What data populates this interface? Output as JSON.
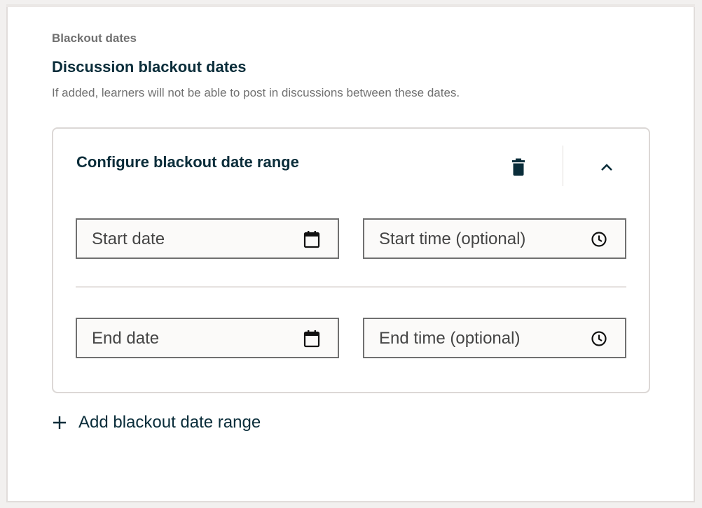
{
  "section": {
    "label": "Blackout dates",
    "title": "Discussion blackout dates",
    "description": "If added, learners will not be able to post in discussions between these dates."
  },
  "card": {
    "title": "Configure blackout date range",
    "delete_icon": "trash-icon",
    "collapse_icon": "chevron-up-icon",
    "fields": {
      "start_date": {
        "placeholder": "Start date",
        "icon": "calendar-icon"
      },
      "start_time": {
        "placeholder": "Start time (optional)",
        "icon": "clock-icon"
      },
      "end_date": {
        "placeholder": "End date",
        "icon": "calendar-icon"
      },
      "end_time": {
        "placeholder": "End time (optional)",
        "icon": "clock-icon"
      }
    }
  },
  "add_range": {
    "label": "Add blackout date range",
    "icon": "plus-icon"
  },
  "colors": {
    "heading": "#0a2d3a",
    "muted": "#707070",
    "field_border": "#707070",
    "card_border": "#dcd8d6",
    "field_bg": "#fbfaf9"
  }
}
